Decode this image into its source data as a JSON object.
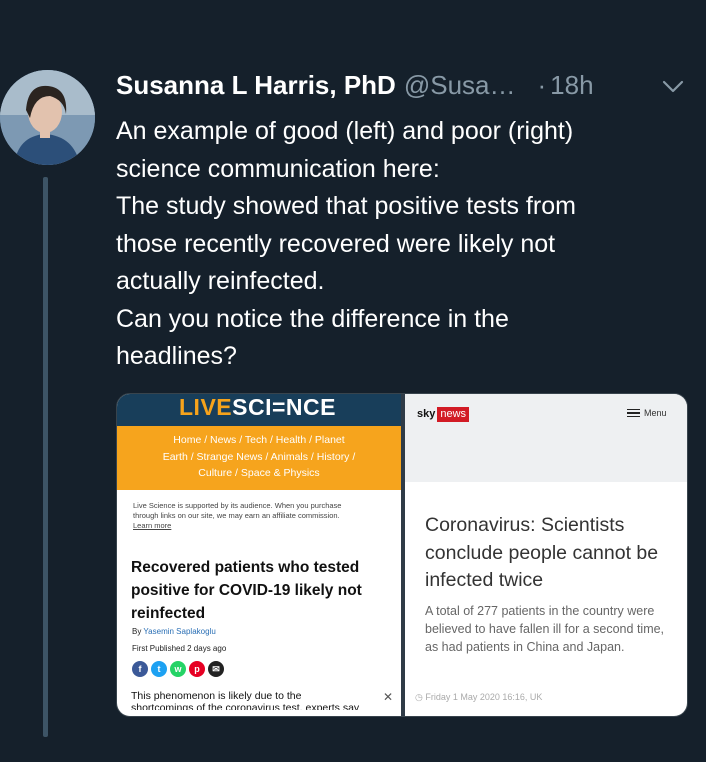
{
  "tweet": {
    "author_name": "Susanna L Harris, PhD",
    "handle": "@Susa…",
    "separator": "·",
    "time": "18h",
    "text_lines": [
      "An example of good (left) and poor (right)",
      "science communication here:",
      "The study showed that positive tests from",
      "those recently recovered were likely not",
      "actually reinfected.",
      "Can you notice the difference in the",
      "headlines?"
    ]
  },
  "left_article": {
    "logo_live": "LIVE",
    "logo_science": "SCI=NCE",
    "nav_line1": "Home  /  News  /  Tech  /  Health  /  Planet",
    "nav_line2": "Earth  /  Strange News  /  Animals  /  History  /",
    "nav_line3": "Culture  /  Space & Physics",
    "support_line1": "Live Science is supported by its audience. When you purchase",
    "support_line2": "through links on our site, we may earn an affiliate commission.",
    "learn_more": "Learn more",
    "headline": "Recovered patients who tested positive for COVID-19 likely not reinfected",
    "by_label": "By",
    "author": "Yasemin Saplakoglu",
    "published": "First Published  2 days ago",
    "paragraph_line1": "This phenomenon is likely due to the",
    "paragraph_line2": "shortcomings of the coronavirus test, experts say",
    "close": "✕"
  },
  "right_article": {
    "logo_sky": "sky",
    "logo_news": "news",
    "menu": "Menu",
    "headline": "Coronavirus: Scientists conclude people cannot be infected twice",
    "body": "A total of 277 patients in the country were believed to have fallen ill for a second time, as had patients in China and Japan.",
    "date": "Friday 1 May 2020 16:16, UK"
  },
  "colors": {
    "background": "#15202b",
    "secondary_text": "#8899a6",
    "livescience_orange": "#f6a41d",
    "livescience_navy": "#183e5a",
    "sky_red": "#d21b25"
  }
}
